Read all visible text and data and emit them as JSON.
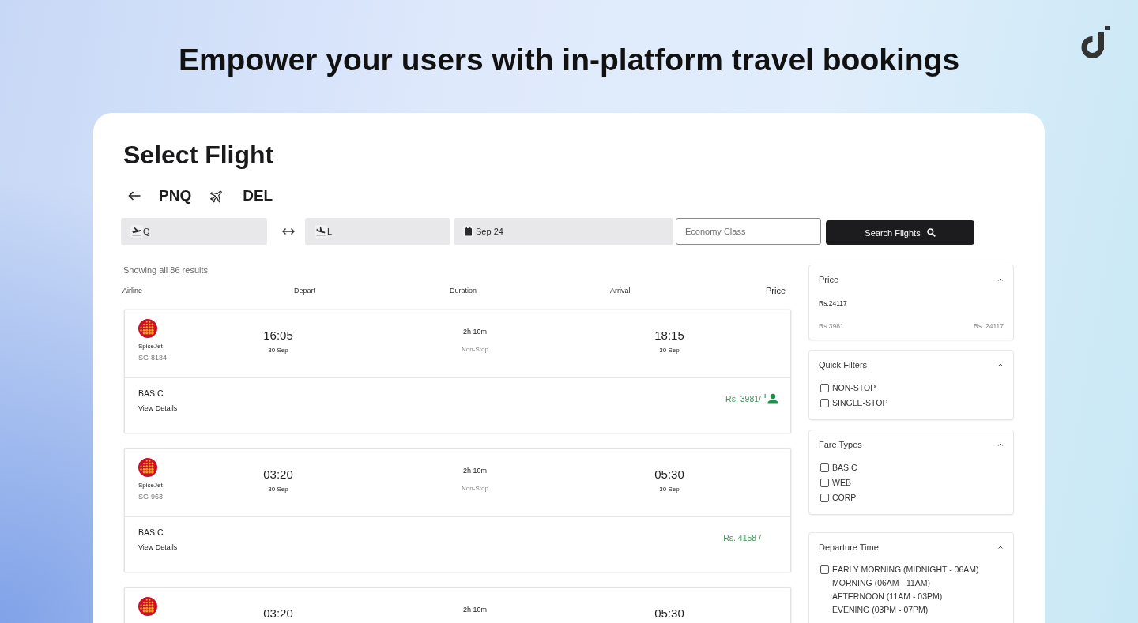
{
  "header": {
    "headline": "Empower your users with in-platform travel bookings"
  },
  "page": {
    "title": "Select Flight"
  },
  "route": {
    "origin": "PNQ",
    "destination": "DEL"
  },
  "search": {
    "origin": {
      "value": "Q"
    },
    "destination": {
      "value": "L"
    },
    "date": {
      "value": "Sep 24"
    },
    "cabin": {
      "placeholder": "Economy Class"
    },
    "button": "Search Flights"
  },
  "results": {
    "summary": "Showing all 86 results",
    "columns": [
      "Airline",
      "Depart",
      "Duration",
      "Arrival",
      "Price"
    ],
    "flights": [
      {
        "airline": "SpiceJet",
        "flight_number": "SG-8184",
        "depart_time": "16:05",
        "depart_date": "30 Sep",
        "duration": "2h 10m",
        "stops": "Non-Stop",
        "arrival_time": "18:15",
        "arrival_date": "30 Sep",
        "fare_type": "BASIC",
        "details_link": "View Details",
        "price": "Rs. 3981/",
        "per_person_icon": true
      },
      {
        "airline": "SpiceJet",
        "flight_number": "SG-963",
        "depart_time": "03:20",
        "depart_date": "30 Sep",
        "duration": "2h 10m",
        "stops": "Non-Stop",
        "arrival_time": "05:30",
        "arrival_date": "30 Sep",
        "fare_type": "BASIC",
        "details_link": "View Details",
        "price": "Rs. 4158 /",
        "per_person_icon": false
      },
      {
        "depart_time": "03:20",
        "duration": "2h 10m",
        "arrival_time": "05:30"
      }
    ]
  },
  "filters": [
    {
      "kind": "range",
      "title": "Price",
      "expanded": true,
      "current": "Rs.24117",
      "min": "Rs.3981",
      "max": "Rs. 24117"
    },
    {
      "kind": "options",
      "title": "Quick Filters",
      "expanded": true,
      "options": [
        {
          "kind": "checkbox",
          "label": "NON-STOP",
          "checked": false
        },
        {
          "kind": "checkbox",
          "label": "SINGLE-STOP",
          "checked": false
        }
      ]
    },
    {
      "kind": "options",
      "title": "Fare Types",
      "expanded": true,
      "options": [
        {
          "kind": "checkbox",
          "label": "BASIC",
          "checked": false
        },
        {
          "kind": "checkbox",
          "label": "WEB",
          "checked": false
        },
        {
          "kind": "checkbox",
          "label": "CORP",
          "checked": false
        }
      ]
    },
    {
      "kind": "options",
      "title": "Departure Time",
      "expanded": true,
      "options": [
        {
          "kind": "checkbox",
          "label": "EARLY MORNING (MIDNIGHT - 06AM)",
          "checked": false
        },
        {
          "kind": "plain",
          "label": "MORNING (06AM - 11AM)"
        },
        {
          "kind": "plain",
          "label": "AFTERNOON (11AM - 03PM)"
        },
        {
          "kind": "plain",
          "label": "EVENING (03PM - 07PM)"
        }
      ]
    }
  ]
}
